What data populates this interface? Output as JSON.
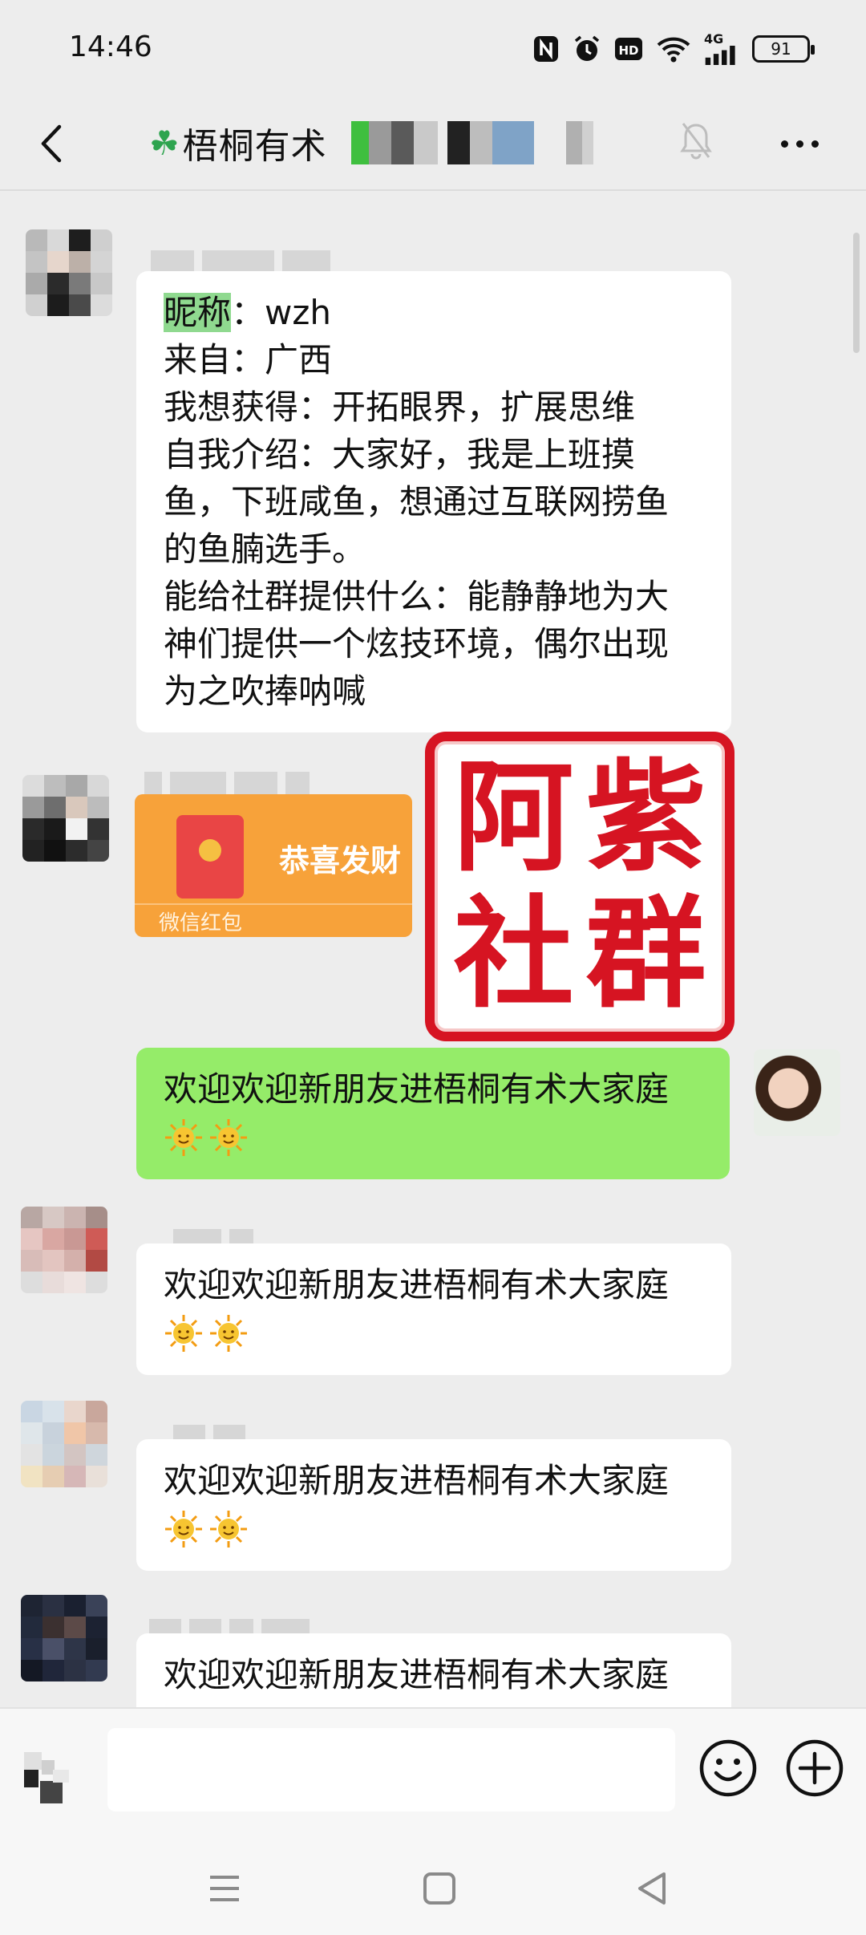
{
  "status_bar": {
    "time": "14:46",
    "network": "4G",
    "hd": "HD",
    "battery": "91"
  },
  "header": {
    "title": "梧桐有术",
    "clover": "☘"
  },
  "messages": [
    {
      "type": "text",
      "highlight": "昵称",
      "lines": [
        "：wzh",
        "来自：广西",
        "我想获得：开拓眼界，扩展思维",
        "自我介绍：大家好，我是上班摸",
        "鱼，下班咸鱼，想通过互联网捞鱼",
        "的鱼腩选手。",
        "能给社群提供什么：能静静地为大",
        "神们提供一个炫技环境，偶尔出现",
        "为之吹捧呐喊"
      ]
    },
    {
      "type": "red_packet",
      "title": "恭喜发财",
      "label": "微信红包"
    },
    {
      "type": "text_self",
      "text": "欢迎欢迎新朋友进梧桐有术大家庭"
    },
    {
      "type": "text",
      "text": "欢迎欢迎新朋友进梧桐有术大家庭"
    },
    {
      "type": "text",
      "text": "欢迎欢迎新朋友进梧桐有术大家庭"
    },
    {
      "type": "text",
      "text": "欢迎欢迎新朋友进梧桐有术大家庭"
    }
  ],
  "stamp": [
    "阿",
    "紫",
    "社",
    "群"
  ],
  "colors": {
    "background": "#ededed",
    "self_bubble": "#95ec69",
    "stamp_red": "#d61422",
    "red_packet": "#f7a23a"
  }
}
